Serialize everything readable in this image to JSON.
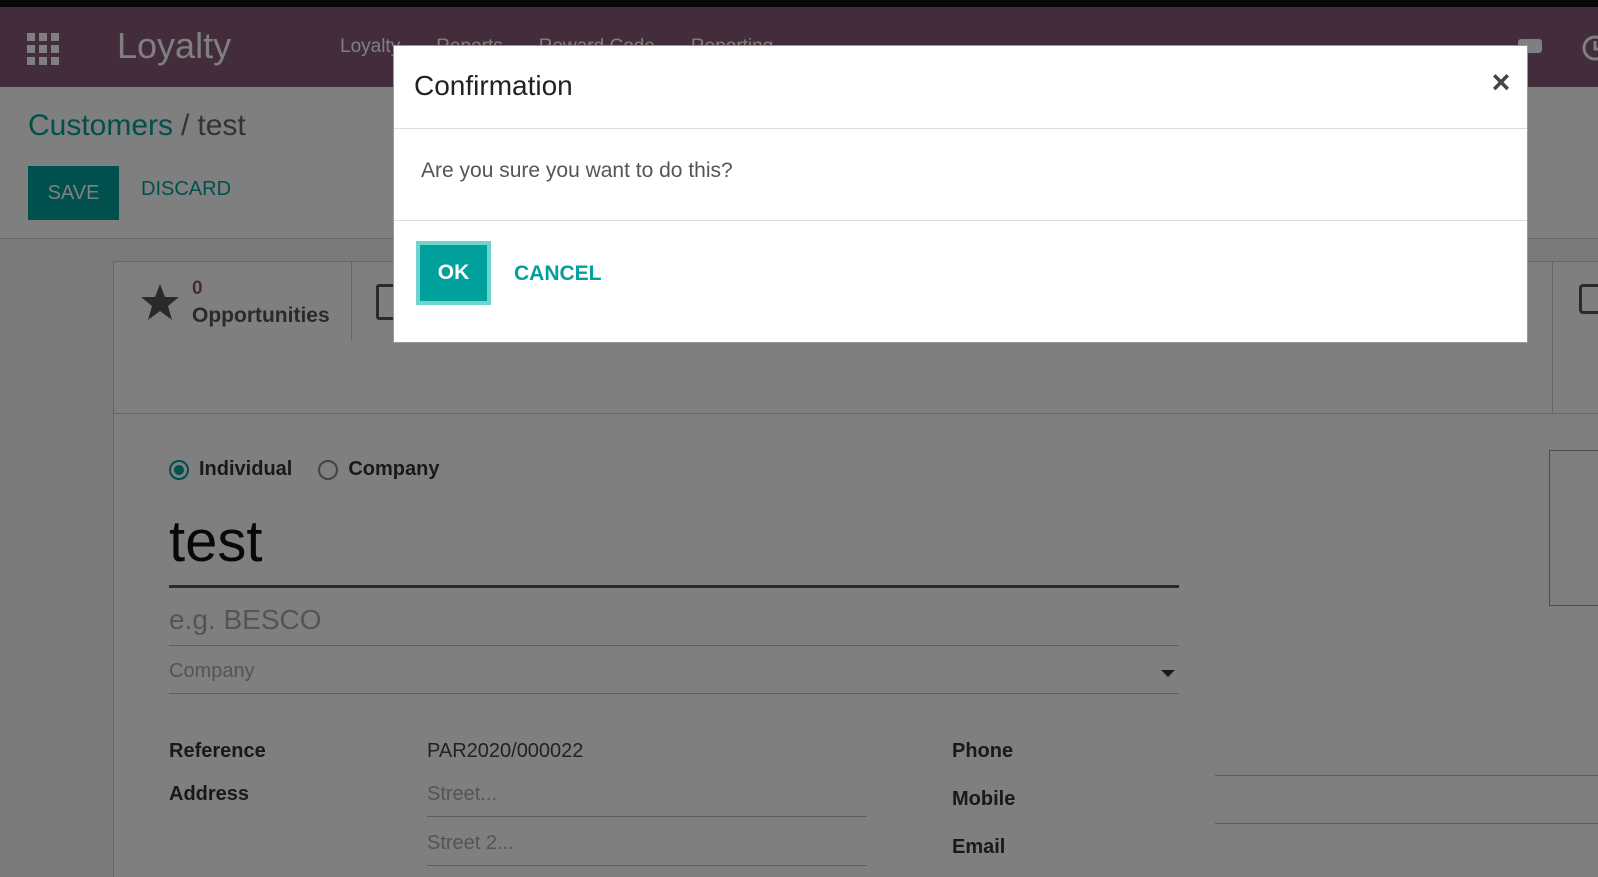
{
  "navbar": {
    "brand": "Loyalty",
    "menu": [
      "Loyalty",
      "Reports",
      "Reward Code",
      "Reporting"
    ]
  },
  "breadcrumb": {
    "parent": "Customers",
    "separator": "/",
    "current": "test"
  },
  "actions": {
    "save_label": "SAVE",
    "discard_label": "DISCARD"
  },
  "buttonbox": {
    "opportunities_count": "0",
    "opportunities_label": "Opportunities"
  },
  "form": {
    "type_options": [
      "Individual",
      "Company"
    ],
    "selected_type": "Individual",
    "name_value": "test",
    "reference_placeholder": "e.g. BESCO",
    "company_placeholder": "Company",
    "reference_label": "Reference",
    "reference_value": "PAR2020/000022",
    "address_label": "Address",
    "street_placeholder": "Street...",
    "street2_placeholder": "Street 2...",
    "phone_label": "Phone",
    "mobile_label": "Mobile",
    "email_label": "Email"
  },
  "modal": {
    "title": "Confirmation",
    "close_symbol": "×",
    "message": "Are you sure you want to do this?",
    "ok_label": "OK",
    "cancel_label": "CANCEL"
  },
  "colors": {
    "navbar": "#875a7b",
    "accent": "#00a09d"
  }
}
